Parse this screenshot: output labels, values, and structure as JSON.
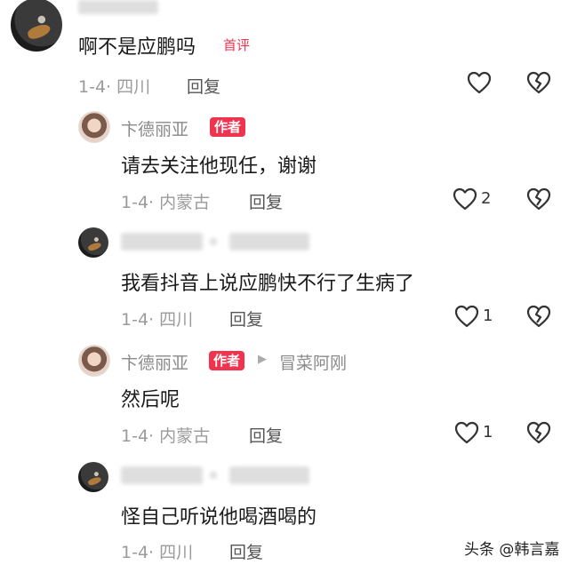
{
  "comments": [
    {
      "text": "啊不是应鹏吗",
      "badge": "首评",
      "date": "1-4",
      "location": "四川",
      "reply": "回复",
      "likes": ""
    },
    {
      "name": "卞德丽亚",
      "badge": "作者",
      "text": "请去关注他现任，谢谢",
      "date": "1-4",
      "location": "内蒙古",
      "reply": "回复",
      "likes": "2"
    },
    {
      "text": "我看抖音上说应鹏快不行了生病了",
      "date": "1-4",
      "location": "四川",
      "reply": "回复",
      "likes": "1"
    },
    {
      "name": "卞德丽亚",
      "badge": "作者",
      "reply_to_arrow": "▶",
      "reply_to": "冒菜阿刚",
      "text": "然后呢",
      "date": "1-4",
      "location": "内蒙古",
      "reply": "回复",
      "likes": "1"
    },
    {
      "text": "怪自己听说他喝酒喝的",
      "date": "1-4",
      "location": "四川",
      "reply": "回复"
    }
  ],
  "sep": "·",
  "watermark": "头条 @韩言嘉",
  "icons": {
    "like": "heart-outline-icon",
    "dislike": "broken-heart-icon",
    "avatar_user": "guitar-player-avatar",
    "avatar_author": "woman-avatar"
  }
}
